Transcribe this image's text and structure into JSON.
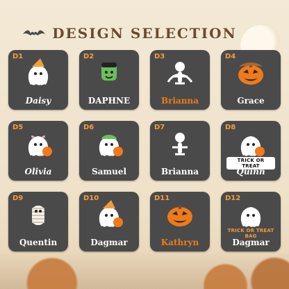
{
  "header": {
    "title": "DESIGN SELECTION"
  },
  "designs": [
    {
      "code": "D1",
      "name": "Daisy",
      "style": "italic",
      "color": "#ffffff",
      "icon": "ghost-witch-hat-icon"
    },
    {
      "code": "D2",
      "name": "DAPHNE",
      "style": "plain",
      "color": "#ffffff",
      "icon": "frankenstein-icon"
    },
    {
      "code": "D3",
      "name": "Brianna",
      "style": "orange",
      "color": "#f07a1a",
      "icon": "skeleton-dinosaur-icon"
    },
    {
      "code": "D4",
      "name": "Grace",
      "style": "plain",
      "color": "#ffffff",
      "icon": "pumpkin-cowboy-icon"
    },
    {
      "code": "D5",
      "name": "Olivia",
      "style": "italic",
      "color": "#ffffff",
      "icon": "ghost-bow-pumpkin-icon"
    },
    {
      "code": "D6",
      "name": "Samuel",
      "style": "plain",
      "color": "#ffffff",
      "icon": "ghost-cap-pumpkin-icon"
    },
    {
      "code": "D7",
      "name": "Brianna",
      "style": "plain",
      "color": "#ffffff",
      "icon": "skeleton-sitting-icon"
    },
    {
      "code": "D8",
      "name": "Quinn",
      "style": "italic",
      "color": "#ffffff",
      "icon": "trick-or-treat-pumpkin-ghost-icon",
      "badge": "TRICK OR TREAT"
    },
    {
      "code": "D9",
      "name": "Quentin",
      "style": "plain",
      "color": "#ffffff",
      "icon": "mummy-icon"
    },
    {
      "code": "D10",
      "name": "Dagmar",
      "style": "plain",
      "color": "#ffffff",
      "icon": "ghost-witch-hat-pumpkin-icon"
    },
    {
      "code": "D11",
      "name": "Kathryn",
      "style": "orange",
      "color": "#f07a1a",
      "icon": "jack-o-lantern-icon"
    },
    {
      "code": "D12",
      "name": "Dagmar",
      "style": "plain",
      "color": "#ffffff",
      "icon": "trick-or-treat-bag-candy-ghost-icon",
      "badge": "TRICK OR TREAT BAG"
    }
  ]
}
